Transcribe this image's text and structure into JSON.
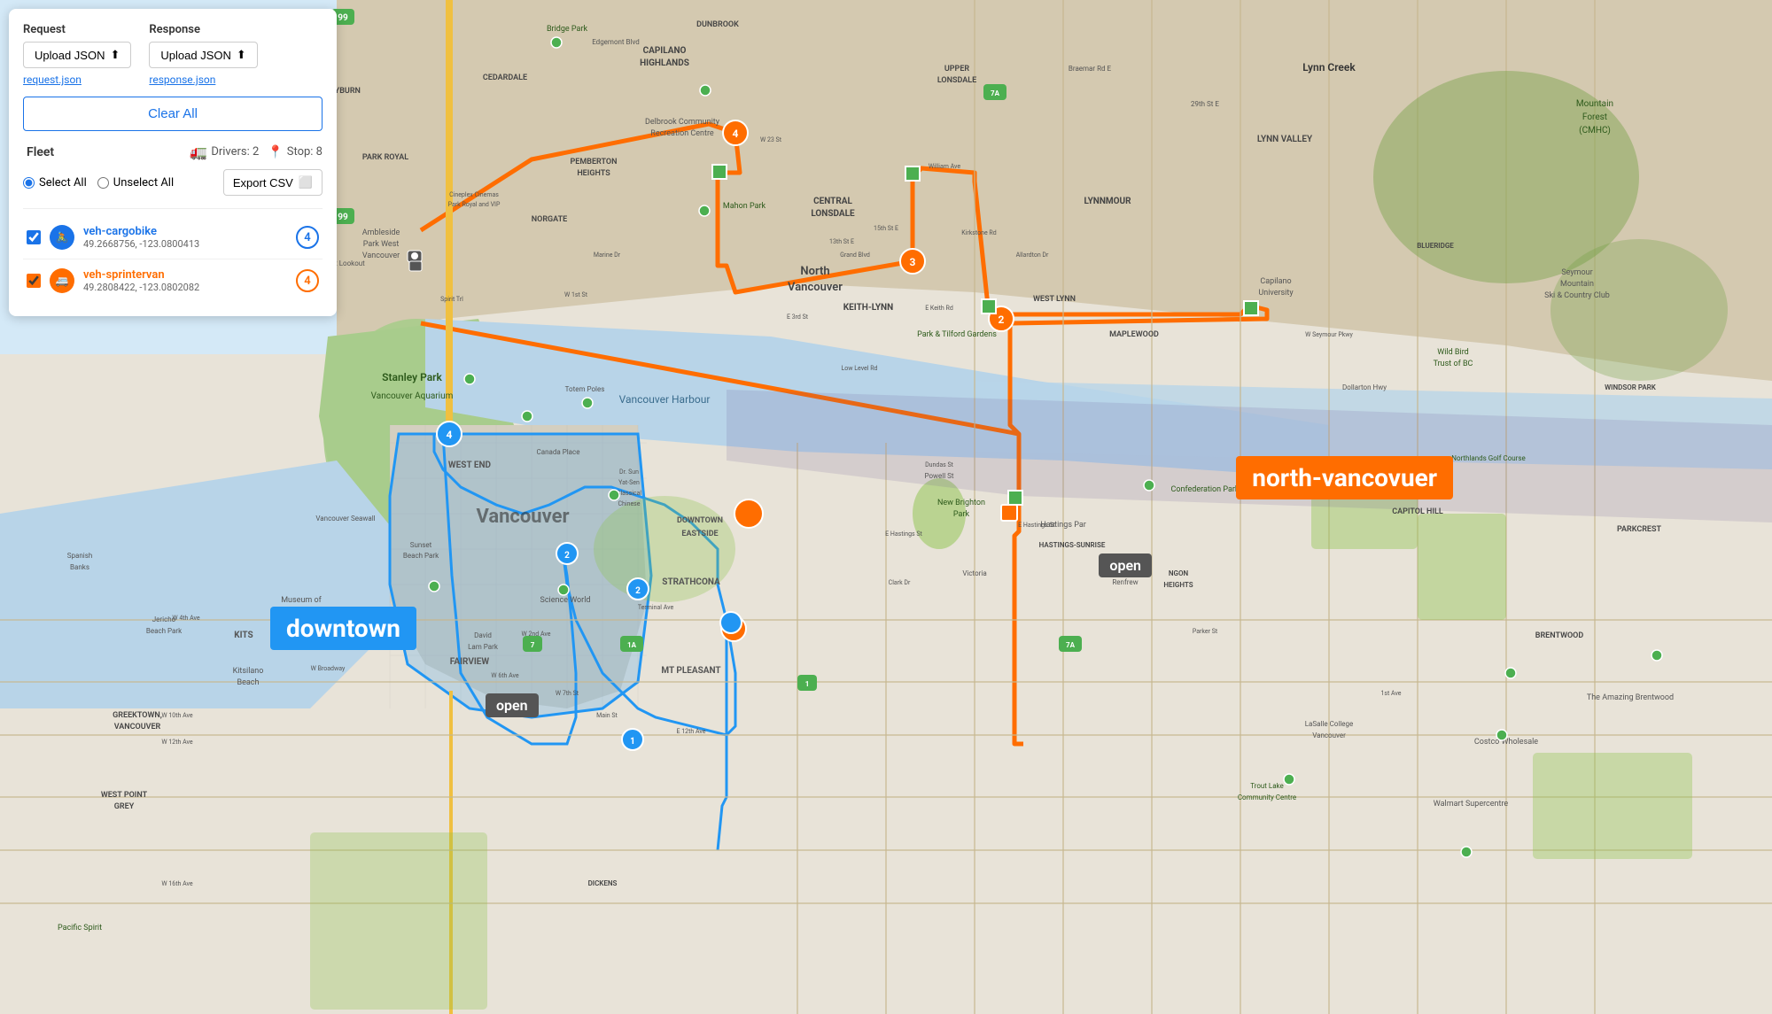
{
  "sidebar": {
    "request_label": "Request",
    "response_label": "Response",
    "upload_btn_label": "Upload JSON",
    "request_file": "request.json",
    "response_file": "response.json",
    "clear_all_label": "Clear All",
    "fleet_label": "Fleet",
    "drivers_label": "Drivers: 2",
    "stop_label": "Stop: 8",
    "select_all_label": "Select All",
    "unselect_all_label": "Unselect All",
    "export_csv_label": "Export CSV",
    "vehicles": [
      {
        "id": "veh-cargobike",
        "name": "veh-cargobike",
        "coords": "49.2668756, -123.0800413",
        "count": 4,
        "color": "blue",
        "checked": true
      },
      {
        "id": "veh-sprintervan",
        "name": "veh-sprintervan",
        "coords": "49.2808422, -123.0802082",
        "count": 4,
        "color": "orange",
        "checked": true
      }
    ]
  },
  "map": {
    "zones": {
      "downtown_label": "downtown",
      "north_label": "north-vancovuer",
      "open_label_1": "open",
      "open_label_2": "open"
    },
    "place_names": [
      "Stanley Park",
      "Vancouver Aquarium",
      "Vancouver Seawall",
      "Museum of Vancouver",
      "Kitsilano Beach",
      "Science World",
      "Vancouver Harbour",
      "WEST END",
      "DOWNTOWN EASTSIDE",
      "STRATHCONA",
      "FAIRVIEW",
      "MT PLEASANT",
      "KITS",
      "CAPILANO HIGHLANDS",
      "CENTRAL LONSDALE",
      "North Vancouver",
      "KEITH-LYNN",
      "LYNNMOUR",
      "GREEKTOWN, VANCOUVER",
      "WEST POINT GREY",
      "Park & Tilford Gardens",
      "New Brighton Park",
      "Hastings Par",
      "Confederation Park",
      "CAPITOL HILL",
      "BRENTWOOD",
      "PARKCREST",
      "LaSalle College Vancouver",
      "Trout Lake Community Centre",
      "Costco Wholesale",
      "Walmart Supercentre",
      "The Amazing Brentwood"
    ],
    "routes": {
      "orange_route": "orange route across north",
      "blue_route": "downtown blue polygon"
    }
  }
}
